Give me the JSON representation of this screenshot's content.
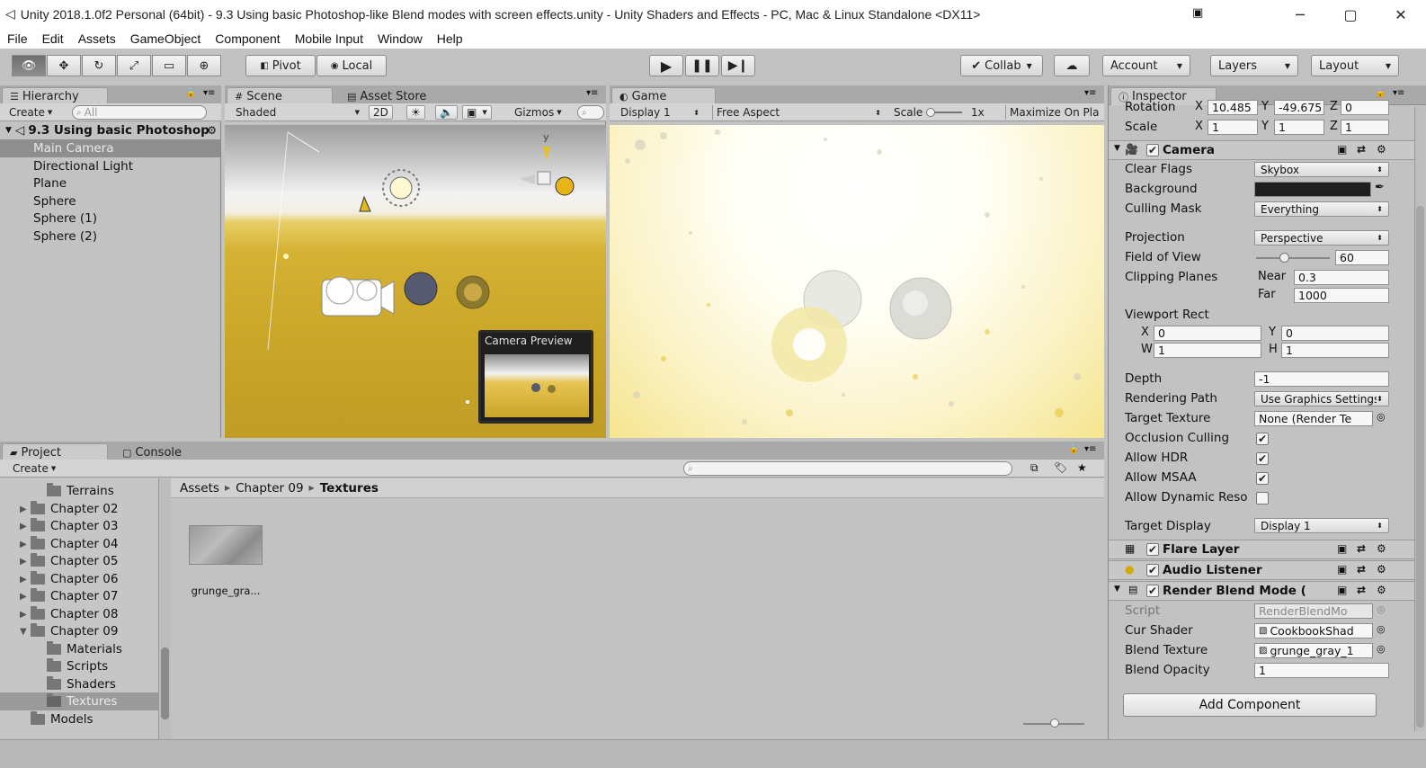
{
  "window": {
    "title": "Unity 2018.1.0f2 Personal (64bit) - 9.3 Using basic Photoshop-like Blend modes with screen effects.unity - Unity Shaders and Effects - PC, Mac & Linux Standalone <DX11>"
  },
  "menu": [
    "File",
    "Edit",
    "Assets",
    "GameObject",
    "Component",
    "Mobile Input",
    "Window",
    "Help"
  ],
  "toolbar": {
    "pivot": "Pivot",
    "local": "Local",
    "collab": "Collab",
    "account": "Account",
    "layers": "Layers",
    "layout": "Layout"
  },
  "hierarchy": {
    "tab": "Hierarchy",
    "create": "Create",
    "search_placeholder": "All",
    "scene_name": "9.3 Using basic Photoshop",
    "items": [
      "Main Camera",
      "Directional Light",
      "Plane",
      "Sphere",
      "Sphere (1)",
      "Sphere (2)"
    ]
  },
  "scene": {
    "tab": "Scene",
    "tab2": "Asset Store",
    "shaded": "Shaded",
    "mode2d": "2D",
    "gizmos": "Gizmos",
    "camera_preview": "Camera Preview",
    "axis_y": "y"
  },
  "game": {
    "tab": "Game",
    "display": "Display 1",
    "aspect": "Free Aspect",
    "scale": "Scale",
    "scale_value": "1x",
    "maximize": "Maximize On Pla"
  },
  "inspector": {
    "tab": "Inspector",
    "rotation": {
      "label": "Rotation",
      "x": "10.485",
      "y": "-49.675",
      "z": "0"
    },
    "scale": {
      "label": "Scale",
      "x": "1",
      "y": "1",
      "z": "1"
    },
    "camera": {
      "title": "Camera",
      "clear_flags": {
        "label": "Clear Flags",
        "value": "Skybox"
      },
      "background": {
        "label": "Background"
      },
      "culling_mask": {
        "label": "Culling Mask",
        "value": "Everything"
      },
      "projection": {
        "label": "Projection",
        "value": "Perspective"
      },
      "fov": {
        "label": "Field of View",
        "value": "60"
      },
      "clipping": {
        "label": "Clipping Planes",
        "near_label": "Near",
        "near": "0.3",
        "far_label": "Far",
        "far": "1000"
      },
      "viewport": {
        "label": "Viewport Rect",
        "x": "0",
        "y": "0",
        "w": "1",
        "h": "1"
      },
      "depth": {
        "label": "Depth",
        "value": "-1"
      },
      "rendering_path": {
        "label": "Rendering Path",
        "value": "Use Graphics Settings"
      },
      "target_texture": {
        "label": "Target Texture",
        "value": "None (Render Te"
      },
      "occlusion": "Occlusion Culling",
      "hdr": "Allow HDR",
      "msaa": "Allow MSAA",
      "dynamic": "Allow Dynamic Reso",
      "target_display": {
        "label": "Target Display",
        "value": "Display 1"
      }
    },
    "flare_layer": "Flare Layer",
    "audio_listener": "Audio Listener",
    "blend_mode": {
      "title": "Render Blend Mode (",
      "script": {
        "label": "Script",
        "value": "RenderBlendMo"
      },
      "cur_shader": {
        "label": "Cur Shader",
        "value": "CookbookShad"
      },
      "blend_texture": {
        "label": "Blend Texture",
        "value": "grunge_gray_1"
      },
      "blend_opacity": {
        "label": "Blend Opacity",
        "value": "1"
      }
    },
    "add_component": "Add Component",
    "axis_labels": {
      "x": "X",
      "y": "Y",
      "z": "Z",
      "w": "W",
      "h": "H"
    }
  },
  "project": {
    "tab": "Project",
    "tab2": "Console",
    "create": "Create",
    "tree": [
      "Terrains",
      "Chapter 02",
      "Chapter 03",
      "Chapter 04",
      "Chapter 05",
      "Chapter 06",
      "Chapter 07",
      "Chapter 08",
      "Chapter 09",
      "Materials",
      "Scripts",
      "Shaders",
      "Textures",
      "Models"
    ],
    "breadcrumb": [
      "Assets",
      "Chapter 09",
      "Textures"
    ],
    "asset_name": "grunge_gra..."
  },
  "colors": {
    "accent_selected": "#8f8f8f",
    "scene_ground": "#c9a528",
    "camera_bg": "#1e1e1e"
  }
}
